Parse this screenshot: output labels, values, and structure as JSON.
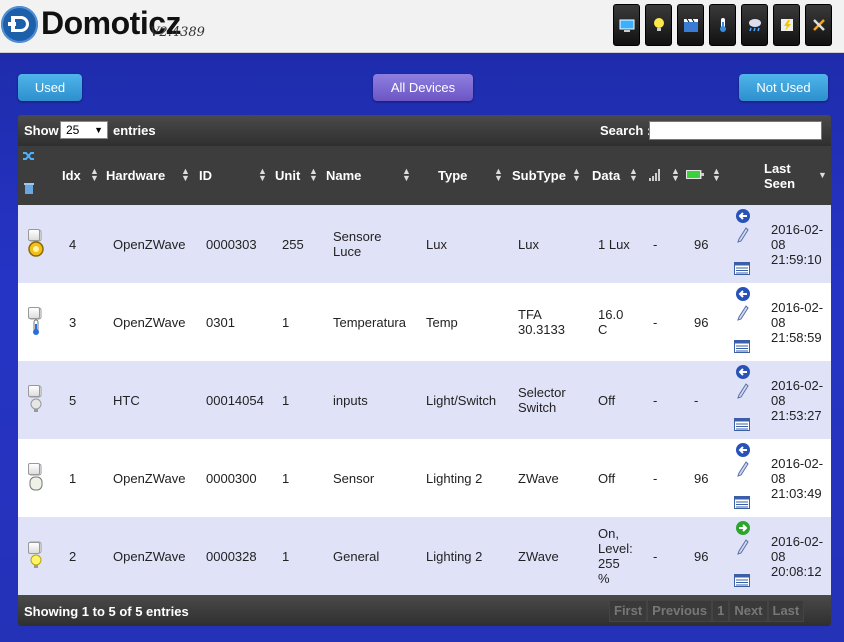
{
  "app": {
    "brand": "Domoticz",
    "version": "V2.4389"
  },
  "top_buttons": [
    {
      "name": "dashboard-icon"
    },
    {
      "name": "light-bulb-icon"
    },
    {
      "name": "scenes-icon"
    },
    {
      "name": "temperature-icon"
    },
    {
      "name": "weather-icon"
    },
    {
      "name": "utility-icon"
    },
    {
      "name": "setup-icon"
    }
  ],
  "filters": {
    "used": "Used",
    "all": "All Devices",
    "not_used": "Not Used"
  },
  "toolbar": {
    "show_label": "Show",
    "page_length": "25",
    "entries_label": "entries",
    "search_label": "Search :",
    "search_value": ""
  },
  "columns": {
    "idx": "Idx",
    "hardware": "Hardware",
    "id": "ID",
    "unit": "Unit",
    "name": "Name",
    "type": "Type",
    "subtype": "SubType",
    "data": "Data",
    "last_seen_1": "Last",
    "last_seen_2": "Seen"
  },
  "rows": [
    {
      "idx": "4",
      "hardware": "OpenZWave",
      "id": "0000303",
      "unit": "255",
      "name": [
        "Sensore",
        "Luce"
      ],
      "type": "Lux",
      "subtype": [
        "Lux"
      ],
      "data": [
        "1 Lux"
      ],
      "signal": "-",
      "battery": "96",
      "last_seen": [
        "2016-02-",
        "08",
        "21:59:10"
      ],
      "icon": "lux-icon"
    },
    {
      "idx": "3",
      "hardware": "OpenZWave",
      "id": "0301",
      "unit": "1",
      "name": [
        "Temperatura"
      ],
      "type": "Temp",
      "subtype": [
        "TFA",
        "30.3133"
      ],
      "data": [
        "16.0",
        "C"
      ],
      "signal": "-",
      "battery": "96",
      "last_seen": [
        "2016-02-",
        "08",
        "21:58:59"
      ],
      "icon": "thermometer-icon"
    },
    {
      "idx": "5",
      "hardware": "HTC",
      "id": "00014054",
      "unit": "1",
      "name": [
        "inputs"
      ],
      "type": "Light/Switch",
      "subtype": [
        "Selector",
        "Switch"
      ],
      "data": [
        "Off"
      ],
      "signal": "-",
      "battery": "-",
      "last_seen": [
        "2016-02-",
        "08",
        "21:53:27"
      ],
      "icon": "bulb-off-icon"
    },
    {
      "idx": "1",
      "hardware": "OpenZWave",
      "id": "0000300",
      "unit": "1",
      "name": [
        "Sensor"
      ],
      "type": "Lighting 2",
      "subtype": [
        "ZWave"
      ],
      "data": [
        "Off"
      ],
      "signal": "-",
      "battery": "96",
      "last_seen": [
        "2016-02-",
        "08",
        "21:03:49"
      ],
      "icon": "sensor-icon"
    },
    {
      "idx": "2",
      "hardware": "OpenZWave",
      "id": "0000328",
      "unit": "1",
      "name": [
        "General"
      ],
      "type": "Lighting 2",
      "subtype": [
        "ZWave"
      ],
      "data": [
        "On,",
        "Level:",
        "255",
        "%"
      ],
      "signal": "-",
      "battery": "96",
      "last_seen": [
        "2016-02-",
        "08",
        "20:08:12"
      ],
      "icon": "bulb-on-icon"
    }
  ],
  "footer": {
    "showing": "Showing 1 to 5 of 5 entries",
    "pager": [
      "First",
      "Previous",
      "1",
      "Next",
      "Last"
    ]
  },
  "colors": {
    "background": "#2634c6",
    "row_odd": "#e0e3f8",
    "row_even": "#ffffff",
    "used_button": "#2d8fcd",
    "all_button": "#6b55c4"
  }
}
